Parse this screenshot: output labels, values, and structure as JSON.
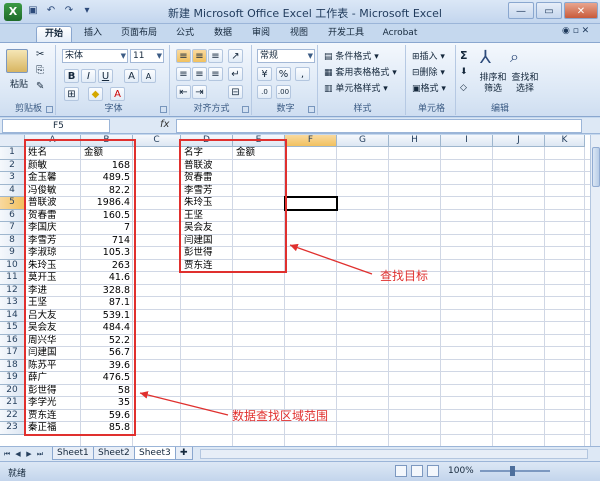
{
  "window": {
    "title": "新建 Microsoft Office Excel 工作表 - Microsoft Excel"
  },
  "ribbon_tabs": [
    "开始",
    "插入",
    "页面布局",
    "公式",
    "数据",
    "审阅",
    "视图",
    "开发工具",
    "Acrobat"
  ],
  "ribbon": {
    "clipboard": {
      "label": "剪贴板",
      "paste": "粘贴"
    },
    "font": {
      "label": "字体",
      "name": "宋体",
      "size": "11",
      "bold": "B",
      "italic": "I",
      "underline": "U",
      "grow": "A",
      "shrink": "A"
    },
    "alignment": {
      "label": "对齐方式"
    },
    "number": {
      "label": "数字",
      "format": "常规",
      "percent": "%",
      "comma": ","
    },
    "styles": {
      "label": "样式",
      "conditional": "条件格式",
      "table": "套用表格格式",
      "cell": "单元格样式"
    },
    "cells": {
      "label": "单元格",
      "insert": "插入",
      "delete": "删除",
      "format": "格式"
    },
    "editing": {
      "label": "编辑",
      "sum": "Σ",
      "sort": "排序和筛选",
      "find": "查找和选择"
    }
  },
  "formula_bar": {
    "name_box": "F5",
    "fx": "fx"
  },
  "columns": [
    "A",
    "B",
    "C",
    "D",
    "E",
    "F",
    "G",
    "H",
    "I",
    "J",
    "K"
  ],
  "rows": [
    "1",
    "2",
    "3",
    "4",
    "5",
    "6",
    "7",
    "8",
    "9",
    "10",
    "11",
    "12",
    "13",
    "14",
    "15",
    "16",
    "17",
    "18",
    "19",
    "20",
    "21",
    "22",
    "23"
  ],
  "data_range": {
    "headers": [
      "姓名",
      "金额"
    ],
    "rows": [
      [
        "颜敏",
        "168"
      ],
      [
        "金玉馨",
        "489.5"
      ],
      [
        "冯俊敏",
        "82.2"
      ],
      [
        "普联波",
        "1986.4"
      ],
      [
        "贺春雷",
        "160.5"
      ],
      [
        "李国庆",
        "7"
      ],
      [
        "李雪芳",
        "714"
      ],
      [
        "李淑琼",
        "105.3"
      ],
      [
        "朱玲玉",
        "263"
      ],
      [
        "莫开玉",
        "41.6"
      ],
      [
        "李进",
        "328.8"
      ],
      [
        "王坚",
        "87.1"
      ],
      [
        "吕大友",
        "539.1"
      ],
      [
        "吴会友",
        "484.4"
      ],
      [
        "周兴华",
        "52.2"
      ],
      [
        "闫建国",
        "56.7"
      ],
      [
        "陈苏平",
        "39.6"
      ],
      [
        "薛广",
        "476.5"
      ],
      [
        "彭世得",
        "58"
      ],
      [
        "李学光",
        "35"
      ],
      [
        "贾东连",
        "59.6"
      ],
      [
        "秦正福",
        "85.8"
      ]
    ]
  },
  "target_range": {
    "headers": [
      "名字",
      "金额"
    ],
    "names": [
      "普联波",
      "贺春雷",
      "李雪芳",
      "朱玲玉",
      "王坚",
      "吴会友",
      "闫建国",
      "彭世得",
      "贾东连"
    ]
  },
  "annotations": {
    "target": "查找目标",
    "data": "数据查找区域范围",
    "color": "#e0302e"
  },
  "sheets": [
    "Sheet1",
    "Sheet2",
    "Sheet3"
  ],
  "status": {
    "ready": "就绪",
    "zoom": "100%"
  }
}
